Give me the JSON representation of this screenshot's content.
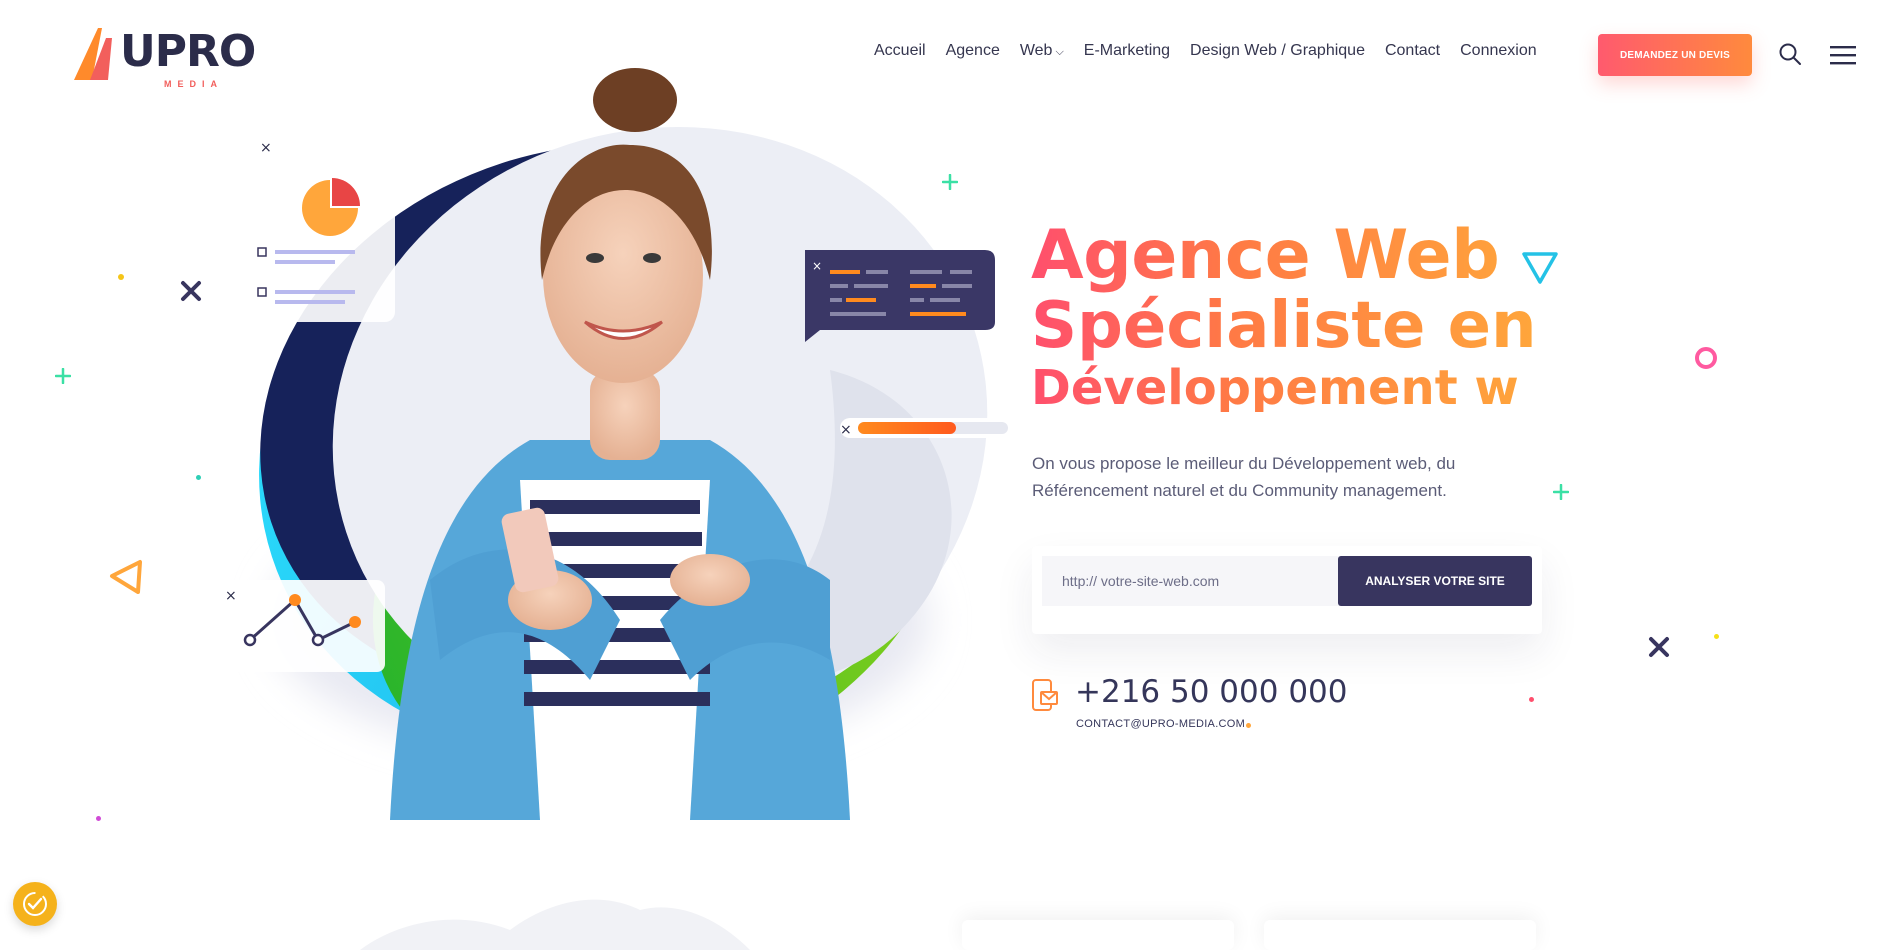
{
  "brand": {
    "logo_main": "UPRO",
    "logo_sub": "MEDIA"
  },
  "nav": {
    "items": [
      {
        "label": "Accueil"
      },
      {
        "label": "Agence"
      },
      {
        "label": "Web",
        "has_dropdown": true
      },
      {
        "label": "E-Marketing"
      },
      {
        "label": "Design Web / Graphique"
      },
      {
        "label": "Contact"
      },
      {
        "label": "Connexion"
      }
    ],
    "dropdown_glyph": "⌵",
    "cta_label": "DEMANDEZ UN DEVIS",
    "search_icon": "search-icon",
    "menu_icon": "hamburger-menu-icon"
  },
  "hero": {
    "title_line1": "Agence Web",
    "title_line2": "Spécialiste en",
    "title_line3": "Développement w",
    "description": "On vous propose le meilleur du Développement web, du Référencement naturel et du Community management.",
    "url_placeholder": "http:// votre-site-web.com",
    "analyze_label": "ANALYSER VOTRE SITE",
    "phone": "+216 50 000 000",
    "email": "CONTACT@UPRO-MEDIA.COM"
  },
  "illustration": {
    "progress_fill": 0.65
  },
  "colors": {
    "accent_start": "#ff4f6d",
    "accent_end": "#ffa63b",
    "dark": "#38355f",
    "text": "#5b5c77"
  }
}
